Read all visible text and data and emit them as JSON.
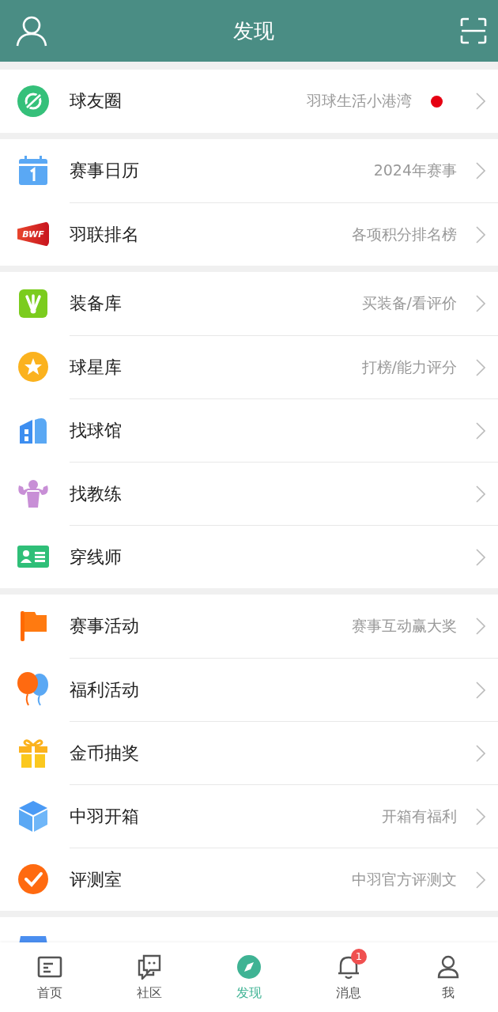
{
  "header": {
    "title": "发现"
  },
  "sections": [
    {
      "items": [
        {
          "label": "球友圈",
          "detail": "羽球生活小港湾",
          "dot": true
        }
      ]
    },
    {
      "items": [
        {
          "label": "赛事日历",
          "detail": "2024年赛事",
          "dot": false
        },
        {
          "label": "羽联排名",
          "detail": "各项积分排名榜",
          "dot": false,
          "logo_text": "BWF"
        }
      ]
    },
    {
      "items": [
        {
          "label": "装备库",
          "detail": "买装备/看评价",
          "dot": false
        },
        {
          "label": "球星库",
          "detail": "打榜/能力评分",
          "dot": false
        },
        {
          "label": "找球馆",
          "dot": false
        },
        {
          "label": "找教练",
          "dot": false
        },
        {
          "label": "穿线师",
          "dot": false
        }
      ]
    },
    {
      "items": [
        {
          "label": "赛事活动",
          "detail": "赛事互动赢大奖",
          "dot": false
        },
        {
          "label": "福利活动",
          "dot": false
        },
        {
          "label": "金币抽奖",
          "dot": false
        },
        {
          "label": "中羽开箱",
          "detail": "开箱有福利",
          "dot": false
        },
        {
          "label": "评测室",
          "detail": "中羽官方评测文",
          "dot": false
        }
      ]
    },
    {
      "items": [
        {
          "kind": "partial"
        }
      ]
    }
  ],
  "tabs": [
    {
      "label": "首页",
      "selected": false
    },
    {
      "label": "社区",
      "selected": false
    },
    {
      "label": "发现",
      "selected": true
    },
    {
      "label": "消息",
      "selected": false,
      "badge": "1"
    },
    {
      "label": "我",
      "selected": false
    }
  ]
}
